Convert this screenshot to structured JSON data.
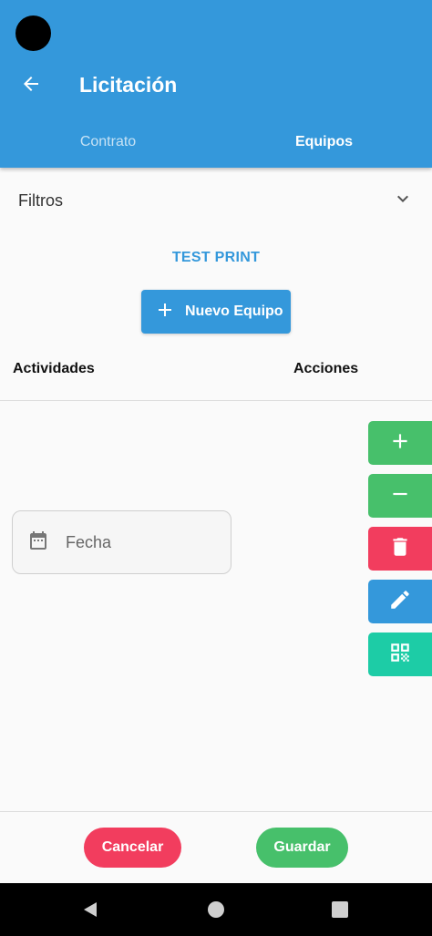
{
  "appbar": {
    "title": "Licitación",
    "tabs": [
      {
        "label": "Contrato",
        "active": false
      },
      {
        "label": "Equipos",
        "active": true
      }
    ],
    "color": "#3498db"
  },
  "filters": {
    "label": "Filtros",
    "icon": "chevron-down-icon"
  },
  "test_print_label": "TEST PRINT",
  "new_button": {
    "label": "Nuevo Equipo",
    "icon": "plus-icon"
  },
  "table_headers": {
    "activities": "Actividades",
    "actions": "Acciones"
  },
  "date_field": {
    "placeholder": "Fecha",
    "icon": "calendar-icon"
  },
  "action_buttons": [
    {
      "name": "add",
      "icon": "plus-icon",
      "color": "#47c06b"
    },
    {
      "name": "remove",
      "icon": "minus-icon",
      "color": "#47c06b"
    },
    {
      "name": "delete",
      "icon": "trash-icon",
      "color": "#f23d5e"
    },
    {
      "name": "edit",
      "icon": "pencil-icon",
      "color": "#3498db"
    },
    {
      "name": "qr",
      "icon": "qr-code-icon",
      "color": "#1dcca6"
    }
  ],
  "footer": {
    "cancel_label": "Cancelar",
    "save_label": "Guardar"
  }
}
